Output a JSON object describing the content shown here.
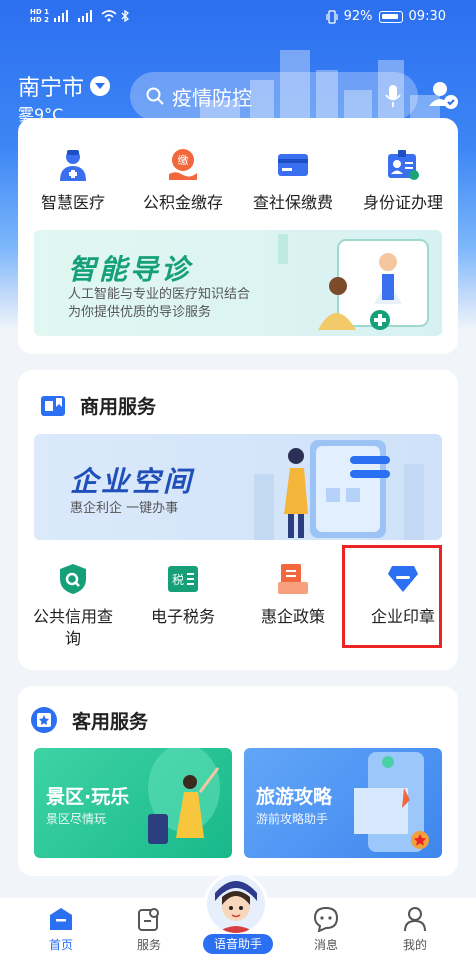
{
  "status_bar": {
    "hd1": "HD 1",
    "hd2": "HD 2",
    "net1": "5G",
    "net2": "4G",
    "battery": "92%",
    "time": "09:30"
  },
  "header": {
    "city": "南宁市",
    "weather": "雾9°C",
    "search_placeholder": "疫情防控"
  },
  "quick_services": [
    {
      "label": "智慧医疗",
      "icon": "doctor-icon"
    },
    {
      "label": "公积金缴存",
      "icon": "fund-payment-icon",
      "badge": "缴"
    },
    {
      "label": "查社保缴费",
      "icon": "bank-card-icon"
    },
    {
      "label": "身份证办理",
      "icon": "id-card-icon"
    }
  ],
  "banner_guide": {
    "title": "智能导诊",
    "subtitle_lines": [
      "人工智能与专业的医疗知识结合",
      "为你提供优质的导诊服务"
    ]
  },
  "business": {
    "title": "商用服务",
    "banner": {
      "title": "企业空间",
      "subtitle": "惠企利企 一键办事"
    },
    "items": [
      {
        "label_lines": [
          "公共信用查",
          "询"
        ],
        "icon": "credit-shield-icon"
      },
      {
        "label_lines": [
          "电子税务"
        ],
        "icon": "tax-icon",
        "badge": "税"
      },
      {
        "label_lines": [
          "惠企政策"
        ],
        "icon": "policy-document-icon"
      },
      {
        "label_lines": [
          "企业印章"
        ],
        "icon": "seal-icon"
      }
    ]
  },
  "guest": {
    "title": "客用服务",
    "tiles": [
      {
        "title": "景区·玩乐",
        "subtitle": "景区尽情玩"
      },
      {
        "title": "旅游攻略",
        "subtitle": "游前攻略助手"
      }
    ]
  },
  "bottom_nav": {
    "home": "首页",
    "service": "服务",
    "voice": "语音助手",
    "message": "消息",
    "mine": "我的"
  },
  "colors": {
    "primary": "#2b6ff2",
    "green": "#1aa37a",
    "orange": "#f2673b",
    "highlight": "#ec2424"
  }
}
